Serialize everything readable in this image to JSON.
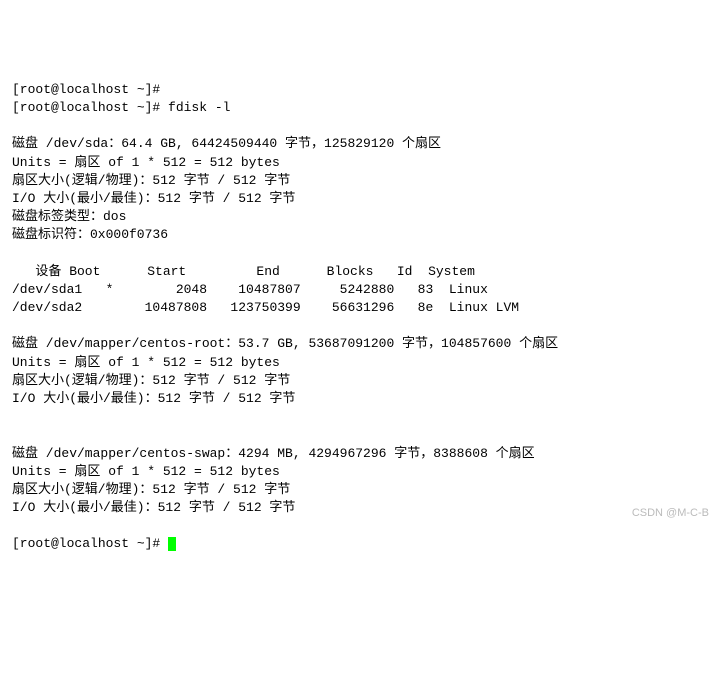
{
  "prompt_empty": "[root@localhost ~]# ",
  "prompt_cmd": "[root@localhost ~]# fdisk -l",
  "disk1": {
    "line1": "磁盘 /dev/sda：64.4 GB, 64424509440 字节，125829120 个扇区",
    "line2": "Units = 扇区 of 1 * 512 = 512 bytes",
    "line3": "扇区大小(逻辑/物理)：512 字节 / 512 字节",
    "line4": "I/O 大小(最小/最佳)：512 字节 / 512 字节",
    "line5": "磁盘标签类型：dos",
    "line6": "磁盘标识符：0x000f0736"
  },
  "table": {
    "header": "   设备 Boot      Start         End      Blocks   Id  System",
    "row1": "/dev/sda1   *        2048    10487807     5242880   83  Linux",
    "row2": "/dev/sda2        10487808   123750399    56631296   8e  Linux LVM"
  },
  "disk2": {
    "line1": "磁盘 /dev/mapper/centos-root：53.7 GB, 53687091200 字节，104857600 个扇区",
    "line2": "Units = 扇区 of 1 * 512 = 512 bytes",
    "line3": "扇区大小(逻辑/物理)：512 字节 / 512 字节",
    "line4": "I/O 大小(最小/最佳)：512 字节 / 512 字节"
  },
  "disk3": {
    "line1": "磁盘 /dev/mapper/centos-swap：4294 MB, 4294967296 字节，8388608 个扇区",
    "line2": "Units = 扇区 of 1 * 512 = 512 bytes",
    "line3": "扇区大小(逻辑/物理)：512 字节 / 512 字节",
    "line4": "I/O 大小(最小/最佳)：512 字节 / 512 字节"
  },
  "prompt_final": "[root@localhost ~]# ",
  "watermark": "CSDN @M-C-B",
  "chart_data": {
    "type": "table",
    "title": "fdisk -l partition table for /dev/sda",
    "columns": [
      "设备",
      "Boot",
      "Start",
      "End",
      "Blocks",
      "Id",
      "System"
    ],
    "rows": [
      [
        "/dev/sda1",
        "*",
        2048,
        10487807,
        5242880,
        "83",
        "Linux"
      ],
      [
        "/dev/sda2",
        "",
        10487808,
        123750399,
        56631296,
        "8e",
        "Linux LVM"
      ]
    ],
    "disks": [
      {
        "device": "/dev/sda",
        "size_gb": 64.4,
        "bytes": 64424509440,
        "sectors": 125829120,
        "label_type": "dos",
        "identifier": "0x000f0736"
      },
      {
        "device": "/dev/mapper/centos-root",
        "size_gb": 53.7,
        "bytes": 53687091200,
        "sectors": 104857600
      },
      {
        "device": "/dev/mapper/centos-swap",
        "size_mb": 4294,
        "bytes": 4294967296,
        "sectors": 8388608
      }
    ]
  }
}
